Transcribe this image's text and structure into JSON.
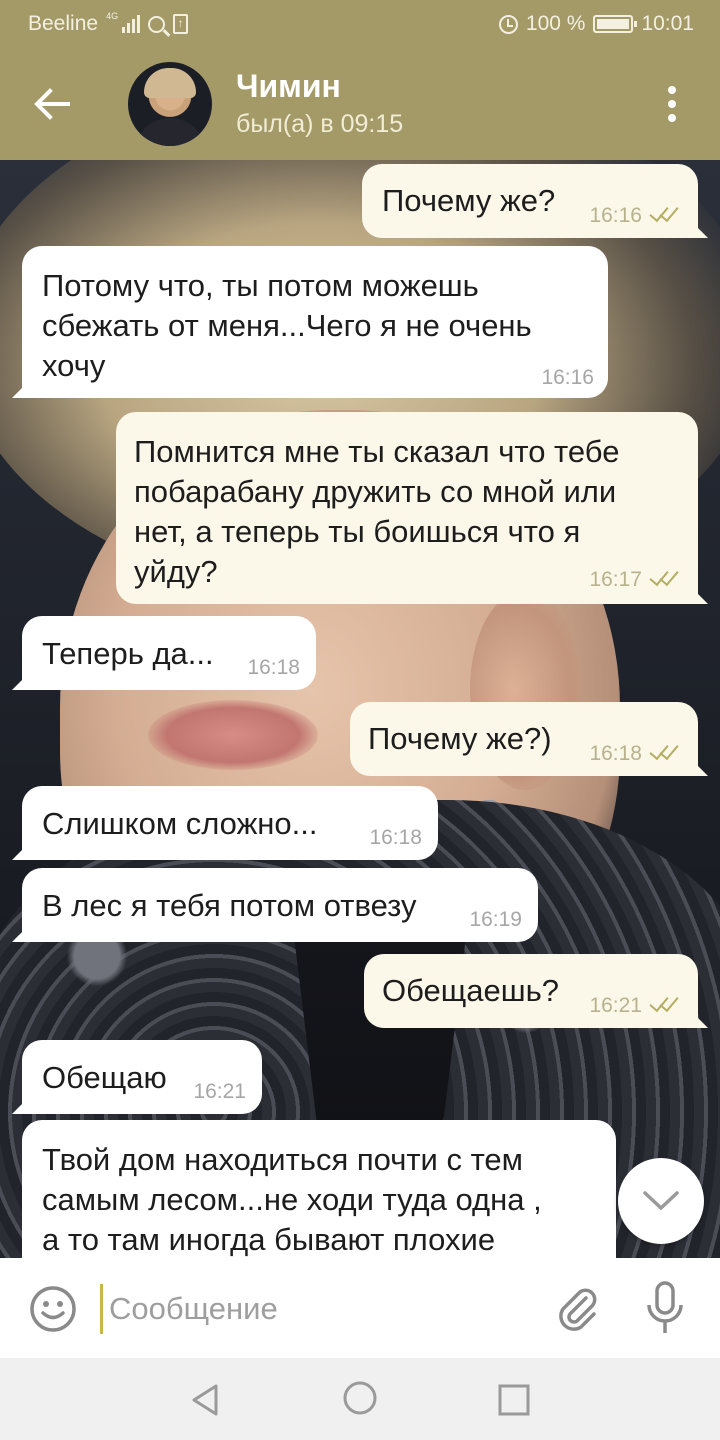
{
  "status_bar": {
    "carrier": "Beeline",
    "network": "4G",
    "battery": "100 %",
    "time": "10:01"
  },
  "header": {
    "contact_name": "Чимин",
    "last_seen": "был(а) в 09:15"
  },
  "messages": [
    {
      "direction": "outgoing",
      "text": "Почему же?",
      "time": "16:16",
      "read": true
    },
    {
      "direction": "incoming",
      "text": "Потому что, ты потом можешь\nсбежать от меня...Чего я не очень\nхочу",
      "time": "16:16"
    },
    {
      "direction": "outgoing",
      "text": "Помнится мне ты сказал что тебе\nпобарабану дружить со мной или\nнет, а теперь ты боишься что я\nуйду?",
      "time": "16:17",
      "read": true
    },
    {
      "direction": "incoming",
      "text": "Теперь да...",
      "time": "16:18"
    },
    {
      "direction": "outgoing",
      "text": "Почему же?)",
      "time": "16:18",
      "read": true
    },
    {
      "direction": "incoming",
      "text": "Слишком сложно...",
      "time": "16:18"
    },
    {
      "direction": "incoming",
      "text": "В лес я тебя потом отвезу",
      "time": "16:19"
    },
    {
      "direction": "outgoing",
      "text": "Обещаешь?",
      "time": "16:21",
      "read": true
    },
    {
      "direction": "incoming",
      "text": "Обещаю",
      "time": "16:21"
    },
    {
      "direction": "incoming",
      "text": "Твой дом находиться почти с тем\nсамым лесом...не ходи туда одна ,\nа то там иногда бывают плохие",
      "time": ""
    }
  ],
  "input": {
    "placeholder": "Сообщение",
    "value": ""
  },
  "icons": {
    "back": "arrow-left-icon",
    "more": "more-vertical-icon",
    "emoji": "emoji-icon",
    "attach": "paperclip-icon",
    "mic": "microphone-icon",
    "scroll_down": "chevron-down-icon"
  },
  "colors": {
    "header_bg": "#a39a68",
    "outgoing_bubble": "#fbf8ea",
    "incoming_bubble": "#ffffff",
    "read_check": "#b4ad62"
  }
}
